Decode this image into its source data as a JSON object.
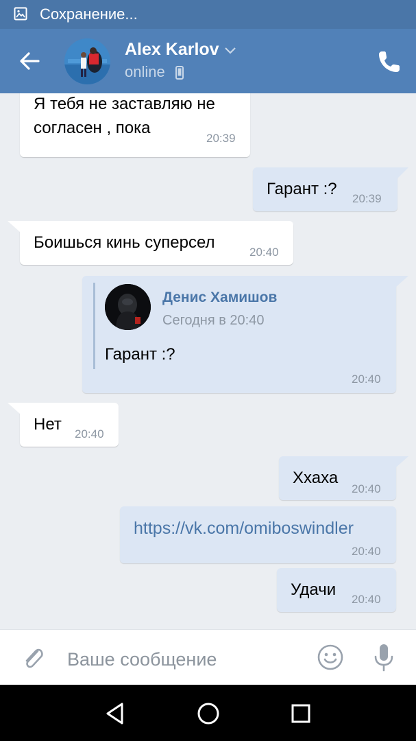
{
  "status_bar": {
    "text": "Сохранение..."
  },
  "header": {
    "contact_name": "Alex Karlov",
    "status": "online"
  },
  "messages": [
    {
      "direction": "in",
      "lines": [
        "Я тебя не заставляю не",
        "согласен , пока"
      ],
      "time": "20:39"
    },
    {
      "direction": "out",
      "text": "Гарант :?",
      "time": "20:39"
    },
    {
      "direction": "in",
      "text": "Боишься кинь суперсел",
      "time": "20:40"
    },
    {
      "direction": "out",
      "forward": {
        "author": "Денис Хамишов",
        "date": "Сегодня в 20:40",
        "text": "Гарант :?"
      },
      "time": "20:40"
    },
    {
      "direction": "in",
      "text": "Нет",
      "time": "20:40"
    },
    {
      "direction": "out",
      "text": "Ххаха",
      "time": "20:40"
    },
    {
      "direction": "out",
      "text": "https://vk.com/omiboswindler",
      "time": "20:40"
    },
    {
      "direction": "out",
      "text": "Удачи",
      "time": "20:40"
    }
  ],
  "input": {
    "placeholder": "Ваше сообщение"
  },
  "colors": {
    "header": "#5181b8",
    "status_bar": "#4a76a8",
    "outgoing": "#dce6f4",
    "incoming": "#ffffff",
    "chat_bg": "#ebeef2",
    "link": "#4a76a8"
  },
  "icons": [
    "image-icon",
    "back-arrow-icon",
    "chevron-down-icon",
    "mobile-phone-icon",
    "phone-call-icon",
    "paperclip-icon",
    "smile-icon",
    "microphone-icon",
    "nav-back-icon",
    "nav-home-icon",
    "nav-recents-icon"
  ]
}
